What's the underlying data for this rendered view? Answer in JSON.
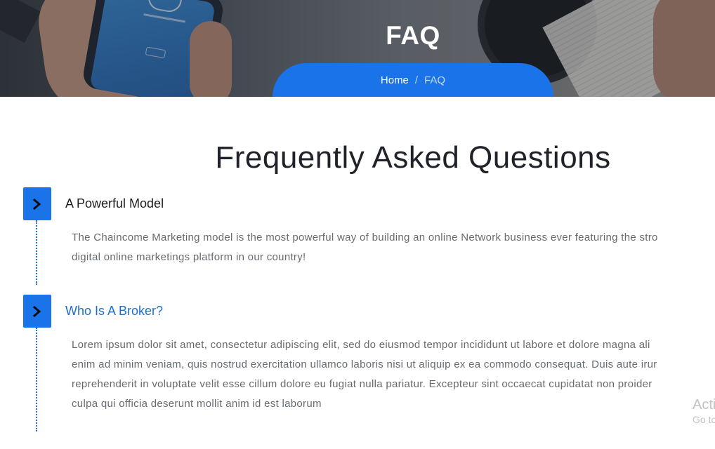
{
  "hero": {
    "title": "FAQ",
    "breadcrumb": {
      "home": "Home",
      "separator": "/",
      "current": "FAQ"
    }
  },
  "section": {
    "title": "Frequently Asked Questions"
  },
  "faq": [
    {
      "question": "A Powerful Model",
      "state": "collapsed",
      "answer_lines": [
        "The Chaincome Marketing model is the most powerful way of building an online Network business ever featuring the stro",
        "digital online marketings platform in our country!"
      ]
    },
    {
      "question": "Who Is A Broker?",
      "state": "active",
      "answer_lines": [
        "Lorem ipsum dolor sit amet, consectetur adipiscing elit, sed do eiusmod tempor incididunt ut labore et dolore magna ali",
        "enim ad minim veniam, quis nostrud exercitation ullamco laboris nisi ut aliquip ex ea commodo consequat. Duis aute irur",
        "reprehenderit in voluptate velit esse cillum dolore eu fugiat nulla pariatur. Excepteur sint occaecat cupidatat non proider",
        "culpa qui officia deserunt mollit anim id est laborum"
      ]
    }
  ],
  "watermark": {
    "title": "Acti",
    "subtitle": "Go to"
  },
  "colors": {
    "accent": "#1a73e8",
    "question_active": "#1f6fd1",
    "body_text": "#666b70"
  },
  "icons": {
    "toggle": "chevron-right-icon"
  }
}
